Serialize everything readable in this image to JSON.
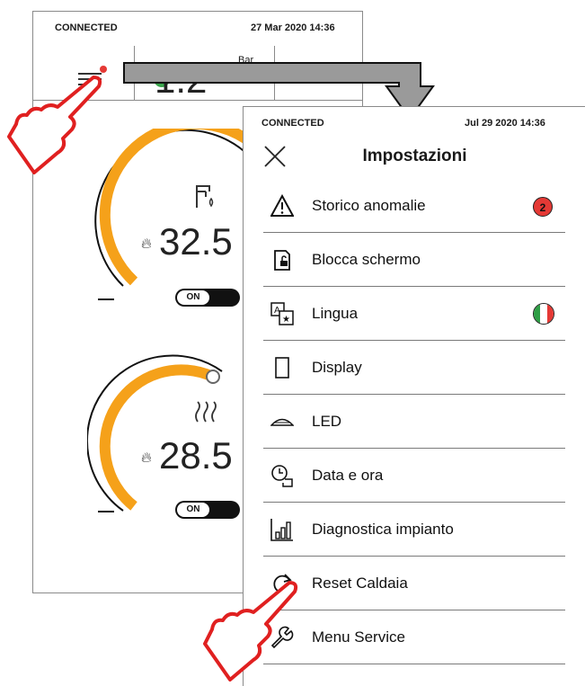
{
  "background_screen": {
    "status": "CONNECTED",
    "date_time": "27 Mar 2020   14:36",
    "pressure": "1.2",
    "pressure_unit": "Bar",
    "dhw": {
      "temperature": "32.5",
      "minus": "–",
      "toggle": "ON",
      "progress": 0.68
    },
    "heating": {
      "temperature": "28.5",
      "minus": "–",
      "toggle": "ON",
      "progress": 0.45
    }
  },
  "panel": {
    "status": "CONNECTED",
    "date_time": "Jul 29 2020   14:36",
    "title": "Impostazioni",
    "items": [
      {
        "label": "Storico anomalie",
        "icon": "warning-icon",
        "badge": "2"
      },
      {
        "label": "Blocca schermo",
        "icon": "lock-screen-icon"
      },
      {
        "label": "Lingua",
        "icon": "language-icon",
        "flag": "italy-flag-icon"
      },
      {
        "label": "Display",
        "icon": "display-icon"
      },
      {
        "label": "LED",
        "icon": "led-icon"
      },
      {
        "label": "Data e ora",
        "icon": "clock-calendar-icon"
      },
      {
        "label": "Diagnostica impianto",
        "icon": "bar-chart-icon"
      },
      {
        "label": "Reset Caldaia",
        "icon": "reset-icon"
      },
      {
        "label": "Menu Service",
        "icon": "wrench-icon"
      }
    ]
  },
  "colors": {
    "accent_orange": "#f5a11a",
    "badge_red": "#e53935",
    "notification_dot": "#e53935",
    "pressure_ok": "#3aa64c",
    "hand_outline": "#e02020"
  }
}
